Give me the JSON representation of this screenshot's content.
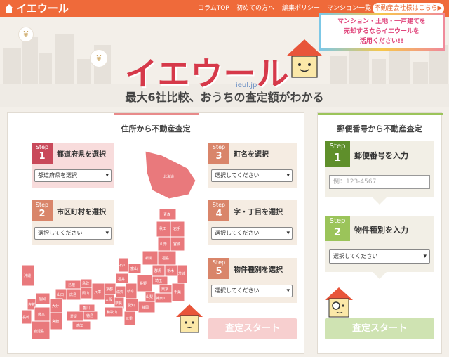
{
  "header": {
    "logo_text": "イエウール",
    "nav": [
      "コラムTOP",
      "初めての方へ",
      "編集ポリシー",
      "マンション一覧"
    ],
    "realtor_button": "不動産会社様はこちら▶"
  },
  "hero": {
    "brand": "イエウール",
    "domain": "ieul.jp",
    "tagline": "最大6社比較、おうちの査定額がわかる",
    "bubble_lines": [
      "マンション・土地・一戸建てを",
      "売却するならイエウールを",
      "活用ください!!"
    ],
    "coin_symbol": "¥"
  },
  "address_panel": {
    "title": "住所から不動産査定",
    "steps": [
      {
        "badge": "Step",
        "num": "1",
        "title": "都道府県を選択",
        "select": "都道府県を選択"
      },
      {
        "badge": "Step",
        "num": "2",
        "title": "市区町村を選択",
        "select": "選択してください"
      },
      {
        "badge": "Step",
        "num": "3",
        "title": "町名を選択",
        "select": "選択してください"
      },
      {
        "badge": "Step",
        "num": "4",
        "title": "字・丁目を選択",
        "select": "選択してください"
      },
      {
        "badge": "Step",
        "num": "5",
        "title": "物件種別を選択",
        "select": "選択してください"
      }
    ],
    "start_button": "査定スタート",
    "map_labels": {
      "hokkaido": "北海道",
      "aomori": "青森",
      "akita": "秋田",
      "iwate": "岩手",
      "yamagata": "山形",
      "miyagi": "宮城",
      "niigata": "新潟",
      "fukushima": "福島",
      "ishikawa": "石川",
      "toyama": "富山",
      "gunma": "群馬",
      "tochigi": "栃木",
      "ibaraki": "茨城",
      "fukui": "福井",
      "nagano": "長野",
      "saitama": "埼玉",
      "tokyo": "東京",
      "chiba": "千葉",
      "kanagawa": "神奈川",
      "yamanashi": "山梨",
      "shizuoka": "静岡",
      "gifu": "岐阜",
      "aichi": "愛知",
      "shiga": "滋賀",
      "kyoto": "京都",
      "hyogo": "兵庫",
      "osaka": "大阪",
      "nara": "奈良",
      "mie": "三重",
      "wakayama": "和歌山",
      "tottori": "鳥取",
      "shimane": "島根",
      "okayama": "岡山",
      "hiroshima": "広島",
      "yamaguchi": "山口",
      "kagawa": "香川",
      "tokushima": "徳島",
      "ehime": "愛媛",
      "kochi": "高知",
      "fukuoka": "福岡",
      "saga": "佐賀",
      "nagasaki": "長崎",
      "oita": "大分",
      "kumamoto": "熊本",
      "miyazaki": "宮崎",
      "kagoshima": "鹿児島",
      "okinawa": "沖縄"
    }
  },
  "postal_panel": {
    "title": "郵便番号から不動産査定",
    "step1": {
      "badge": "Step",
      "num": "1",
      "title": "郵便番号を入力",
      "placeholder": "例：123-4567"
    },
    "step2": {
      "badge": "Step",
      "num": "2",
      "title": "物件種別を入力",
      "select": "選択してください"
    },
    "start_button": "査定スタート"
  },
  "colors": {
    "accent": "#ef6a3a",
    "brand_red": "#d6394a",
    "map": "#e9797c",
    "green": "#9bc45a"
  }
}
